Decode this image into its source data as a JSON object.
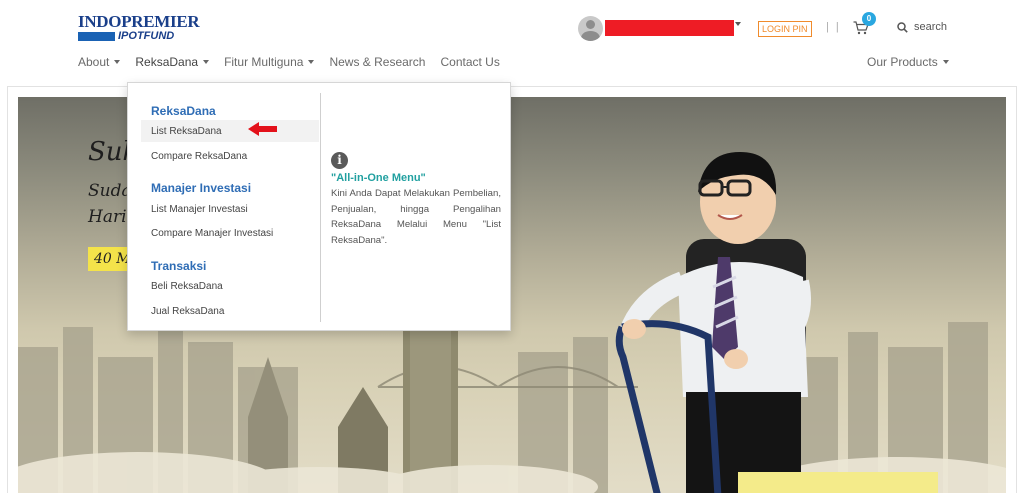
{
  "brand": {
    "name_top": "INDOPREMIER",
    "name_bottom": "IPOTFUND",
    "colors": {
      "primary": "#1a3f8a",
      "accent": "#1a62b4"
    }
  },
  "header": {
    "user_name": "",
    "login_pin": "LOGIN PIN",
    "separator": "| |",
    "cart_count": "0",
    "search_label": "search"
  },
  "nav": {
    "items": [
      {
        "label": "About"
      },
      {
        "label": "ReksaDana"
      },
      {
        "label": "Fitur Multiguna"
      },
      {
        "label": "News & Research"
      },
      {
        "label": "Contact Us"
      }
    ],
    "right_label": "Our Products"
  },
  "hero": {
    "title": "Suks",
    "line1": "Suda",
    "line2": "Hari",
    "badge": "40 M"
  },
  "dropdown": {
    "sections": [
      {
        "heading": "ReksaDana",
        "links": [
          "List ReksaDana",
          "Compare ReksaDana"
        ]
      },
      {
        "heading": "Manajer Investasi",
        "links": [
          "List Manajer Investasi",
          "Compare Manajer Investasi"
        ]
      },
      {
        "heading": "Transaksi",
        "links": [
          "Beli ReksaDana",
          "Jual ReksaDana"
        ]
      }
    ],
    "info": {
      "icon": "info-icon",
      "title": "\"All-in-One Menu\"",
      "text": "Kini Anda Dapat Melakukan Pembelian, Penjualan, hingga Pengalihan ReksaDana Melalui Menu \"List ReksaDana\"."
    }
  }
}
